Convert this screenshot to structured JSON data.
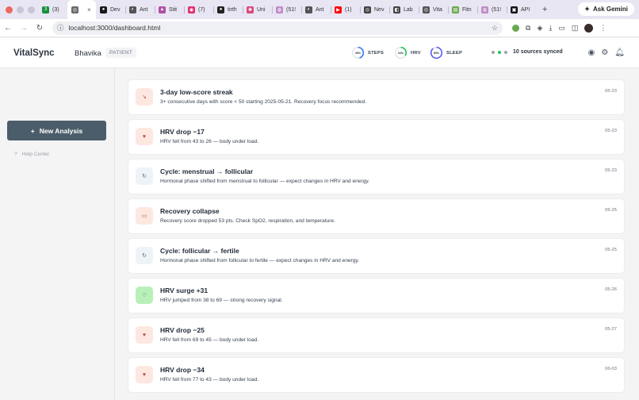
{
  "browser": {
    "tabs": [
      {
        "label": "(3)",
        "color": "#1a8f3c",
        "glyph": "3"
      },
      {
        "label": "",
        "color": "#6b6b6b",
        "glyph": "◎",
        "active": true
      },
      {
        "label": "Dev",
        "color": "#1a1a1a",
        "glyph": "●"
      },
      {
        "label": "Ant",
        "color": "#555555",
        "glyph": "◐"
      },
      {
        "label": "Stit",
        "color": "#b04fa5",
        "glyph": "▲"
      },
      {
        "label": "(7)",
        "color": "#e1306c",
        "glyph": "◉"
      },
      {
        "label": "tirth",
        "color": "#222222",
        "glyph": "●"
      },
      {
        "label": "Uni",
        "color": "#d94a7a",
        "glyph": "✱"
      },
      {
        "label": "(51!",
        "color": "#c08bc7",
        "glyph": "◍"
      },
      {
        "label": "Ant",
        "color": "#555555",
        "glyph": "◐"
      },
      {
        "label": "(1)",
        "color": "#ff0000",
        "glyph": "▶"
      },
      {
        "label": "Nev",
        "color": "#444444",
        "glyph": "◎"
      },
      {
        "label": "Lab",
        "color": "#444444",
        "glyph": "◧"
      },
      {
        "label": "Vita",
        "color": "#555555",
        "glyph": "◎"
      },
      {
        "label": "Fitn",
        "color": "#6aa84f",
        "glyph": "▤"
      },
      {
        "label": "(51!",
        "color": "#c08bc7",
        "glyph": "◍"
      },
      {
        "label": "API",
        "color": "#111111",
        "glyph": "▣"
      }
    ],
    "new_tab": "+",
    "gemini_label": "Ask Gemini",
    "url": "localhost:3000/dashboard.html"
  },
  "app": {
    "brand": "VitalSync",
    "patient_name": "Bhavika",
    "patient_role": "PATIENT",
    "metrics": [
      {
        "pct": "45%",
        "label": "STEPS",
        "value": 45,
        "color": "#3b82f6"
      },
      {
        "pct": "34%",
        "label": "HRV",
        "value": 34,
        "color": "#22c55e"
      },
      {
        "pct": "89%",
        "label": "SLEEP",
        "value": 89,
        "color": "#6366f1"
      }
    ],
    "sync_text": "10 sources synced",
    "sync_dot_colors": [
      "#9ca3af",
      "#22c55e",
      "#9ca3af"
    ]
  },
  "sidebar": {
    "new_analysis": "New Analysis",
    "help": "Help Center"
  },
  "feed": [
    {
      "title": "3-day low-score streak",
      "desc": "3+ consecutive days with score < 50 starting 2025-05-21. Recovery focus recommended.",
      "date": "05-23",
      "icon": "trend-down-icon",
      "glyph": "↘",
      "tone": "warn"
    },
    {
      "title": "HRV drop −17",
      "desc": "HRV fell from 43 to 26 — body under load.",
      "date": "05-23",
      "icon": "heart-icon",
      "glyph": "♥",
      "tone": "warn"
    },
    {
      "title": "Cycle: menstrual → follicular",
      "desc": "Hormonal phase shifted from menstrual to follicular — expect changes in HRV and energy.",
      "date": "05-23",
      "icon": "cycle-icon",
      "glyph": "↻",
      "tone": "cycle"
    },
    {
      "title": "Recovery collapse",
      "desc": "Recovery score dropped 53 pts. Check SpO2, respiration, and temperature.",
      "date": "05-25",
      "icon": "battery-icon",
      "glyph": "▭",
      "tone": "warn"
    },
    {
      "title": "Cycle: follicular → fertile",
      "desc": "Hormonal phase shifted from follicular to fertile — expect changes in HRV and energy.",
      "date": "05-25",
      "icon": "cycle-icon",
      "glyph": "↻",
      "tone": "cycle"
    },
    {
      "title": "HRV surge +31",
      "desc": "HRV jumped from 38 to 69 — strong recovery signal.",
      "date": "05-26",
      "icon": "heart-icon",
      "glyph": "♡",
      "tone": "good"
    },
    {
      "title": "HRV drop −25",
      "desc": "HRV fell from 69 to 45 — body under load.",
      "date": "05-27",
      "icon": "heart-icon",
      "glyph": "♥",
      "tone": "warn"
    },
    {
      "title": "HRV drop −34",
      "desc": "HRV fell from 77 to 43 — body under load.",
      "date": "06-03",
      "icon": "heart-icon",
      "glyph": "♥",
      "tone": "warn"
    }
  ]
}
